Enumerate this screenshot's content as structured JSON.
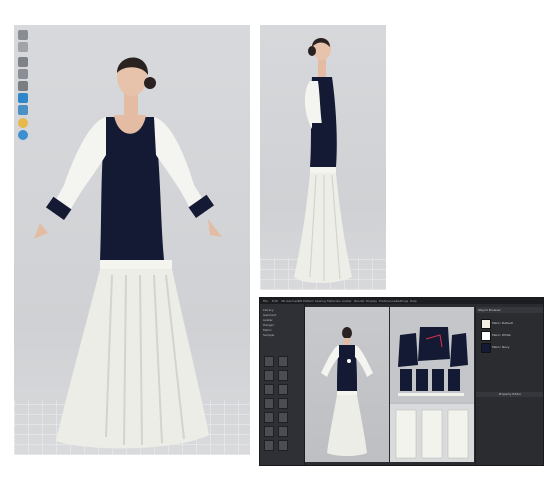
{
  "front_view": {
    "toolbar_icons": [
      "avatar-icon",
      "simulate-icon",
      "hanger-icon",
      "lamp-icon",
      "shirt-icon",
      "shape-icon",
      "bulb-icon",
      "globe-icon"
    ]
  },
  "app": {
    "menus": [
      "File",
      "Edit",
      "3D Garment",
      "2D Pattern",
      "Sewing",
      "Materials",
      "Avatar",
      "Render",
      "Display",
      "Preferences",
      "Settings",
      "Help"
    ],
    "library": {
      "items": [
        "Library",
        "Garment",
        "Avatar",
        "Hanger",
        "Fabric",
        "Sample"
      ]
    },
    "object_browser": {
      "title": "Object Browser",
      "fabrics": [
        {
          "label": "Fabric Default",
          "color": "#f1eee4"
        },
        {
          "label": "Fabric White",
          "color": "#ffffff"
        },
        {
          "label": "Fabric Navy",
          "color": "#141a33"
        }
      ]
    },
    "property_editor": {
      "title": "Property Editor"
    },
    "colors": {
      "dress_navy": "#141a33",
      "dress_white": "#ebebe5",
      "app_bg": "#2a2b2f"
    }
  }
}
